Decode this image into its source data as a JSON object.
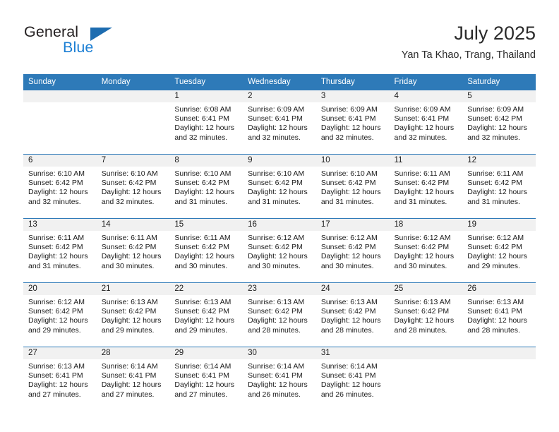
{
  "brand": {
    "name_top": "General",
    "name_bottom": "Blue",
    "triangle_icon": "brand-triangle-icon",
    "color_dark": "#231f20",
    "color_blue": "#1c7fd4"
  },
  "header": {
    "title": "July 2025",
    "subtitle": "Yan Ta Khao, Trang, Thailand",
    "accent_color": "#2e7ab8"
  },
  "calendar": {
    "weekday_headers": [
      "Sunday",
      "Monday",
      "Tuesday",
      "Wednesday",
      "Thursday",
      "Friday",
      "Saturday"
    ],
    "weeks": [
      [
        {
          "day": "",
          "lines": []
        },
        {
          "day": "",
          "lines": []
        },
        {
          "day": "1",
          "lines": [
            "Sunrise: 6:08 AM",
            "Sunset: 6:41 PM",
            "Daylight: 12 hours",
            "and 32 minutes."
          ]
        },
        {
          "day": "2",
          "lines": [
            "Sunrise: 6:09 AM",
            "Sunset: 6:41 PM",
            "Daylight: 12 hours",
            "and 32 minutes."
          ]
        },
        {
          "day": "3",
          "lines": [
            "Sunrise: 6:09 AM",
            "Sunset: 6:41 PM",
            "Daylight: 12 hours",
            "and 32 minutes."
          ]
        },
        {
          "day": "4",
          "lines": [
            "Sunrise: 6:09 AM",
            "Sunset: 6:41 PM",
            "Daylight: 12 hours",
            "and 32 minutes."
          ]
        },
        {
          "day": "5",
          "lines": [
            "Sunrise: 6:09 AM",
            "Sunset: 6:42 PM",
            "Daylight: 12 hours",
            "and 32 minutes."
          ]
        }
      ],
      [
        {
          "day": "6",
          "lines": [
            "Sunrise: 6:10 AM",
            "Sunset: 6:42 PM",
            "Daylight: 12 hours",
            "and 32 minutes."
          ]
        },
        {
          "day": "7",
          "lines": [
            "Sunrise: 6:10 AM",
            "Sunset: 6:42 PM",
            "Daylight: 12 hours",
            "and 32 minutes."
          ]
        },
        {
          "day": "8",
          "lines": [
            "Sunrise: 6:10 AM",
            "Sunset: 6:42 PM",
            "Daylight: 12 hours",
            "and 31 minutes."
          ]
        },
        {
          "day": "9",
          "lines": [
            "Sunrise: 6:10 AM",
            "Sunset: 6:42 PM",
            "Daylight: 12 hours",
            "and 31 minutes."
          ]
        },
        {
          "day": "10",
          "lines": [
            "Sunrise: 6:10 AM",
            "Sunset: 6:42 PM",
            "Daylight: 12 hours",
            "and 31 minutes."
          ]
        },
        {
          "day": "11",
          "lines": [
            "Sunrise: 6:11 AM",
            "Sunset: 6:42 PM",
            "Daylight: 12 hours",
            "and 31 minutes."
          ]
        },
        {
          "day": "12",
          "lines": [
            "Sunrise: 6:11 AM",
            "Sunset: 6:42 PM",
            "Daylight: 12 hours",
            "and 31 minutes."
          ]
        }
      ],
      [
        {
          "day": "13",
          "lines": [
            "Sunrise: 6:11 AM",
            "Sunset: 6:42 PM",
            "Daylight: 12 hours",
            "and 31 minutes."
          ]
        },
        {
          "day": "14",
          "lines": [
            "Sunrise: 6:11 AM",
            "Sunset: 6:42 PM",
            "Daylight: 12 hours",
            "and 30 minutes."
          ]
        },
        {
          "day": "15",
          "lines": [
            "Sunrise: 6:11 AM",
            "Sunset: 6:42 PM",
            "Daylight: 12 hours",
            "and 30 minutes."
          ]
        },
        {
          "day": "16",
          "lines": [
            "Sunrise: 6:12 AM",
            "Sunset: 6:42 PM",
            "Daylight: 12 hours",
            "and 30 minutes."
          ]
        },
        {
          "day": "17",
          "lines": [
            "Sunrise: 6:12 AM",
            "Sunset: 6:42 PM",
            "Daylight: 12 hours",
            "and 30 minutes."
          ]
        },
        {
          "day": "18",
          "lines": [
            "Sunrise: 6:12 AM",
            "Sunset: 6:42 PM",
            "Daylight: 12 hours",
            "and 30 minutes."
          ]
        },
        {
          "day": "19",
          "lines": [
            "Sunrise: 6:12 AM",
            "Sunset: 6:42 PM",
            "Daylight: 12 hours",
            "and 29 minutes."
          ]
        }
      ],
      [
        {
          "day": "20",
          "lines": [
            "Sunrise: 6:12 AM",
            "Sunset: 6:42 PM",
            "Daylight: 12 hours",
            "and 29 minutes."
          ]
        },
        {
          "day": "21",
          "lines": [
            "Sunrise: 6:13 AM",
            "Sunset: 6:42 PM",
            "Daylight: 12 hours",
            "and 29 minutes."
          ]
        },
        {
          "day": "22",
          "lines": [
            "Sunrise: 6:13 AM",
            "Sunset: 6:42 PM",
            "Daylight: 12 hours",
            "and 29 minutes."
          ]
        },
        {
          "day": "23",
          "lines": [
            "Sunrise: 6:13 AM",
            "Sunset: 6:42 PM",
            "Daylight: 12 hours",
            "and 28 minutes."
          ]
        },
        {
          "day": "24",
          "lines": [
            "Sunrise: 6:13 AM",
            "Sunset: 6:42 PM",
            "Daylight: 12 hours",
            "and 28 minutes."
          ]
        },
        {
          "day": "25",
          "lines": [
            "Sunrise: 6:13 AM",
            "Sunset: 6:42 PM",
            "Daylight: 12 hours",
            "and 28 minutes."
          ]
        },
        {
          "day": "26",
          "lines": [
            "Sunrise: 6:13 AM",
            "Sunset: 6:41 PM",
            "Daylight: 12 hours",
            "and 28 minutes."
          ]
        }
      ],
      [
        {
          "day": "27",
          "lines": [
            "Sunrise: 6:13 AM",
            "Sunset: 6:41 PM",
            "Daylight: 12 hours",
            "and 27 minutes."
          ]
        },
        {
          "day": "28",
          "lines": [
            "Sunrise: 6:14 AM",
            "Sunset: 6:41 PM",
            "Daylight: 12 hours",
            "and 27 minutes."
          ]
        },
        {
          "day": "29",
          "lines": [
            "Sunrise: 6:14 AM",
            "Sunset: 6:41 PM",
            "Daylight: 12 hours",
            "and 27 minutes."
          ]
        },
        {
          "day": "30",
          "lines": [
            "Sunrise: 6:14 AM",
            "Sunset: 6:41 PM",
            "Daylight: 12 hours",
            "and 26 minutes."
          ]
        },
        {
          "day": "31",
          "lines": [
            "Sunrise: 6:14 AM",
            "Sunset: 6:41 PM",
            "Daylight: 12 hours",
            "and 26 minutes."
          ]
        },
        {
          "day": "",
          "lines": []
        },
        {
          "day": "",
          "lines": []
        }
      ]
    ]
  }
}
